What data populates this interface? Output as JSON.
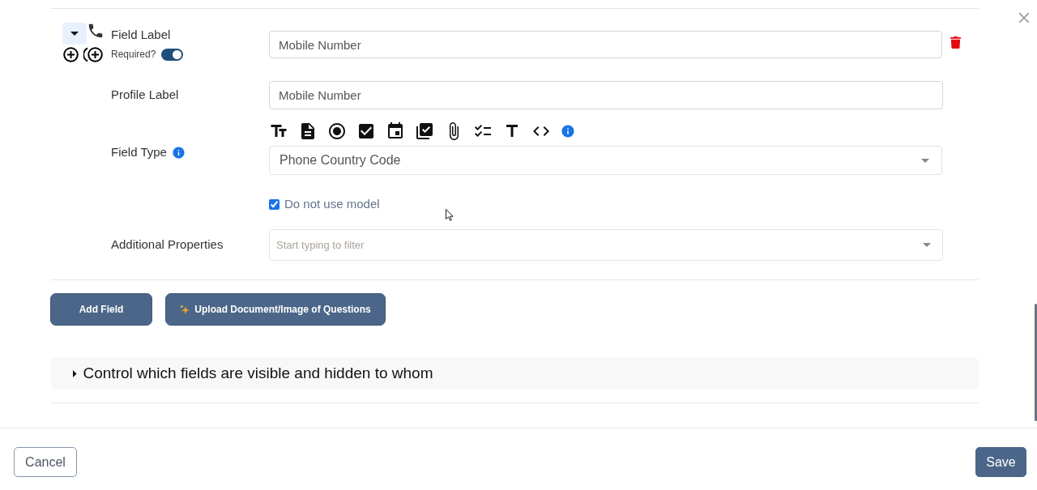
{
  "field": {
    "expanded": true,
    "label": "Field Label",
    "required_label": "Required?",
    "required": true,
    "value": "Mobile Number"
  },
  "profile_label": {
    "label": "Profile Label",
    "value": "Mobile Number"
  },
  "field_type": {
    "label": "Field Type",
    "value": "Phone Country Code"
  },
  "model_option": {
    "label": "Do not use model",
    "checked": true
  },
  "additional_properties": {
    "label": "Additional Properties",
    "placeholder": "Start typing to filter"
  },
  "actions": [
    {
      "label": "Add Field",
      "kind": "plain"
    },
    {
      "label": "Upload Document/Image of Questions",
      "kind": "ai"
    }
  ],
  "visibility_section": {
    "title": "Control which fields are visible and hidden to whom",
    "expanded": false
  },
  "footer": {
    "buttons": [
      {
        "label": "Cancel",
        "kind": "secondary"
      },
      {
        "label": "Save",
        "kind": "primary"
      }
    ]
  }
}
